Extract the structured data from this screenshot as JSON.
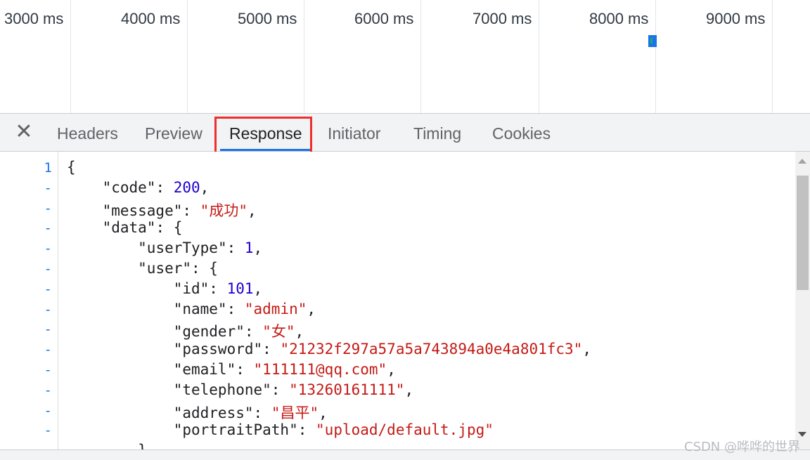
{
  "timeline": {
    "ticks": [
      "3000 ms",
      "4000 ms",
      "5000 ms",
      "6000 ms",
      "7000 ms",
      "8000 ms",
      "9000 ms"
    ]
  },
  "tabs": {
    "close_icon": "close-icon",
    "items": [
      "Headers",
      "Preview",
      "Response",
      "Initiator",
      "Timing",
      "Cookies"
    ],
    "active": "Response"
  },
  "response": {
    "line_number": "1",
    "collapse_marker": "-",
    "lines": [
      [
        "{"
      ],
      [
        "\"code\"",
        ": ",
        "200",
        ","
      ],
      [
        "\"message\"",
        ": ",
        "\"成功\"",
        ","
      ],
      [
        "\"data\"",
        ": {"
      ],
      [
        "\"userType\"",
        ": ",
        "1",
        ","
      ],
      [
        "\"user\"",
        ": {"
      ],
      [
        "\"id\"",
        ": ",
        "101",
        ","
      ],
      [
        "\"name\"",
        ": ",
        "\"admin\"",
        ","
      ],
      [
        "\"gender\"",
        ": ",
        "\"女\"",
        ","
      ],
      [
        "\"password\"",
        ": ",
        "\"21232f297a57a5a743894a0e4a801fc3\"",
        ","
      ],
      [
        "\"email\"",
        ": ",
        "\"111111@qq.com\"",
        ","
      ],
      [
        "\"telephone\"",
        ": ",
        "\"13260161111\"",
        ","
      ],
      [
        "\"address\"",
        ": ",
        "\"昌平\"",
        ","
      ],
      [
        "\"portraitPath\"",
        ": ",
        "\"upload/default.jpg\""
      ],
      [
        "},"
      ]
    ]
  },
  "watermark": "CSDN @哗哗的世界",
  "colors": {
    "accent": "#1a73e8",
    "highlight": "#ef2f2f",
    "string": "#c41a16",
    "number": "#1c00cf"
  }
}
